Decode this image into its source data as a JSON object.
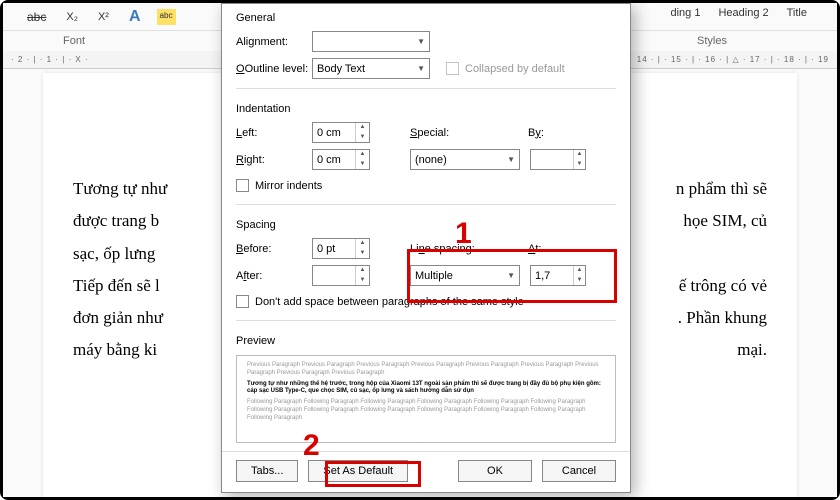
{
  "ribbon": {
    "tools": [
      "abc",
      "X₂",
      "X²",
      "A",
      "ᵃᵇᶜ"
    ],
    "font_label": "Font",
    "styles": [
      "ding 1",
      "Heading 2",
      "Title"
    ],
    "styles_label": "Styles"
  },
  "ruler": {
    "left": "· 2 · | · 1 · | · X ·",
    "right": "14 · | · 15 · | · 16 · | △ · 17 · | · 18 · | · 19"
  },
  "document": {
    "lines": [
      "Tương tự như",
      "được trang b",
      "sạc, ốp lưng",
      "Tiếp đến sẽ l",
      "đơn giản như",
      "máy bằng ki"
    ],
    "lines_right": [
      "n phẩm thì sẽ",
      "họe SIM, củ",
      "",
      "ế trông có vẻ",
      ". Phần khung",
      "mại."
    ]
  },
  "dialog": {
    "general": {
      "title": "General",
      "alignment_label": "Alignment:",
      "alignment_value": "",
      "outline_label": "Outline level:",
      "outline_value": "Body Text",
      "collapsed_label": "Collapsed by default"
    },
    "indentation": {
      "title": "Indentation",
      "left_label": "Left:",
      "left_value": "0 cm",
      "right_label": "Right:",
      "right_value": "0 cm",
      "special_label": "Special:",
      "special_value": "(none)",
      "by_label": "By:",
      "by_value": "",
      "mirror_label": "Mirror indents"
    },
    "spacing": {
      "title": "Spacing",
      "before_label": "Before:",
      "before_value": "0 pt",
      "after_label": "After:",
      "after_value": "",
      "line_spacing_label": "Line spacing:",
      "line_spacing_value": "Multiple",
      "at_label": "At:",
      "at_value": "1,7",
      "dont_add_label": "Don't add space between paragraphs of the same style"
    },
    "preview": {
      "title": "Preview",
      "grey1": "Previous Paragraph Previous Paragraph Previous Paragraph Previous Paragraph Previous Paragraph Previous Paragraph Previous Paragraph Previous Paragraph Previous Paragraph",
      "bold": "Tương tự như những thế hệ trước, trong hộp của Xiaomi 13T ngoài sản phẩm thì sẽ được trang bị đầy đủ bộ phụ kiện gồm: cáp sạc USB Type-C, que chọc SIM, củ sạc, ốp lưng và sách hướng dẫn sử dụn",
      "grey2": "Following Paragraph Following Paragraph Following Paragraph Following Paragraph Following Paragraph Following Paragraph Following Paragraph Following Paragraph Following Paragraph Following Paragraph Following Paragraph Following Paragraph Following Paragraph"
    },
    "buttons": {
      "tabs": "Tabs...",
      "set_default": "Set As Default",
      "ok": "OK",
      "cancel": "Cancel"
    }
  },
  "annotations": {
    "num1": "1",
    "num2": "2"
  }
}
